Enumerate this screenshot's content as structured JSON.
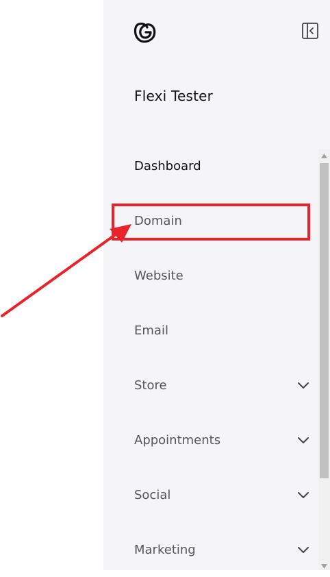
{
  "sidebar": {
    "logo_icon": "godaddy-logo-icon",
    "collapse_icon": "collapse-sidebar-icon",
    "account_name": "Flexi Tester",
    "items": [
      {
        "label": "Dashboard",
        "active": true,
        "has_chevron": false
      },
      {
        "label": "Domain",
        "active": false,
        "has_chevron": false
      },
      {
        "label": "Website",
        "active": false,
        "has_chevron": false
      },
      {
        "label": "Email",
        "active": false,
        "has_chevron": false
      },
      {
        "label": "Store",
        "active": false,
        "has_chevron": true
      },
      {
        "label": "Appointments",
        "active": false,
        "has_chevron": true
      },
      {
        "label": "Social",
        "active": false,
        "has_chevron": true
      },
      {
        "label": "Marketing",
        "active": false,
        "has_chevron": true
      }
    ]
  },
  "annotation": {
    "highlight_color": "#e8232a",
    "target": "Domain"
  },
  "colors": {
    "sidebar_bg": "#f5f5f7",
    "text_primary": "#111111",
    "text_secondary": "#555555"
  }
}
